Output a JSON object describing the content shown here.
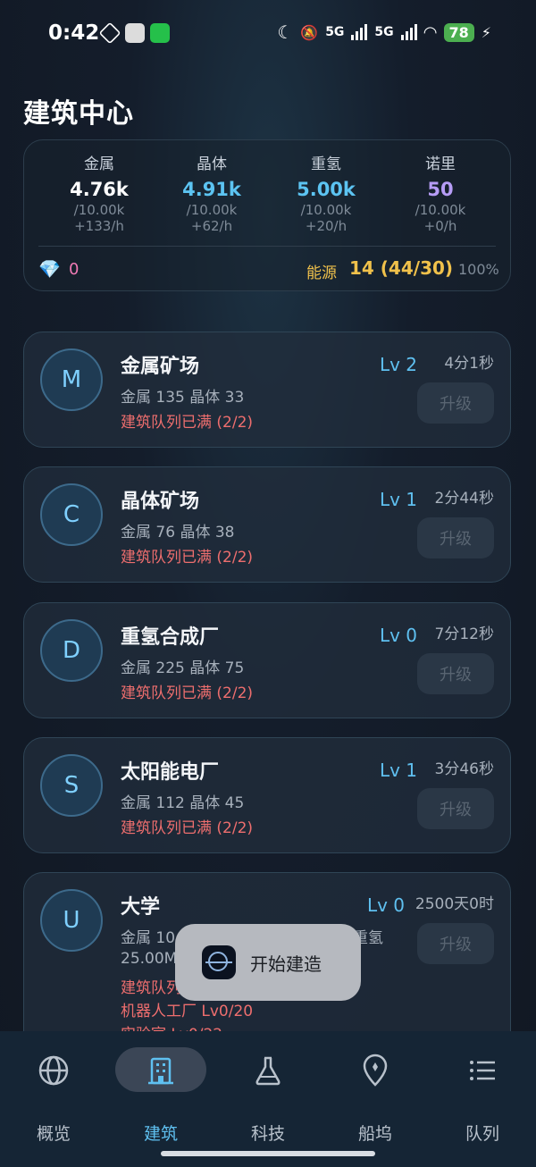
{
  "status_bar": {
    "time": "0:42",
    "signal1": "5G",
    "signal2": "5G",
    "battery": "78"
  },
  "page_title": "建筑中心",
  "resources": [
    {
      "name": "金属",
      "value": "4.76k",
      "cap": "/10.00k",
      "rate": "+133/h",
      "color": "#ffffff"
    },
    {
      "name": "晶体",
      "value": "4.91k",
      "cap": "/10.00k",
      "rate": "+62/h",
      "color": "#5cc4f2"
    },
    {
      "name": "重氢",
      "value": "5.00k",
      "cap": "/10.00k",
      "rate": "+20/h",
      "color": "#5cc4f2"
    },
    {
      "name": "诺里",
      "value": "50",
      "cap": "/10.00k",
      "rate": "+0/h",
      "color": "#b69cf5"
    }
  ],
  "gems": "0",
  "energy": {
    "label": "能源",
    "value": "14 (44/30)",
    "percent": "100%"
  },
  "buildings": [
    {
      "letter": "M",
      "name": "金属矿场",
      "cost": "金属 135  晶体 33",
      "queue": "建筑队列已满 (2/2)",
      "level": "Lv 2",
      "time": "4分1秒",
      "button": "升级"
    },
    {
      "letter": "C",
      "name": "晶体矿场",
      "cost": "金属 76  晶体 38",
      "queue": "建筑队列已满 (2/2)",
      "level": "Lv 1",
      "time": "2分44秒",
      "button": "升级"
    },
    {
      "letter": "D",
      "name": "重氢合成厂",
      "cost": "金属 225  晶体 75",
      "queue": "建筑队列已满 (2/2)",
      "level": "Lv 0",
      "time": "7分12秒",
      "button": "升级"
    },
    {
      "letter": "S",
      "name": "太阳能电厂",
      "cost": "金属 112  晶体 45",
      "queue": "建筑队列已满 (2/2)",
      "level": "Lv 1",
      "time": "3分46秒",
      "button": "升级"
    },
    {
      "letter": "U",
      "name": "大学",
      "cost": "金属 10",
      "cost_tail": "重氢",
      "cost_line2": "25.00M",
      "queue": "建筑队列",
      "req1": "机器人工厂  Lv0/20",
      "req2": "实验室 Lv0/22",
      "level": "Lv 0",
      "time": "2500天0时",
      "button": "升级"
    }
  ],
  "toast": {
    "text": "开始建造"
  },
  "nav": [
    {
      "label": "概览",
      "icon": "globe-icon"
    },
    {
      "label": "建筑",
      "icon": "building-icon"
    },
    {
      "label": "科技",
      "icon": "flask-icon"
    },
    {
      "label": "船坞",
      "icon": "location-pin-icon"
    },
    {
      "label": "队列",
      "icon": "list-icon"
    }
  ]
}
